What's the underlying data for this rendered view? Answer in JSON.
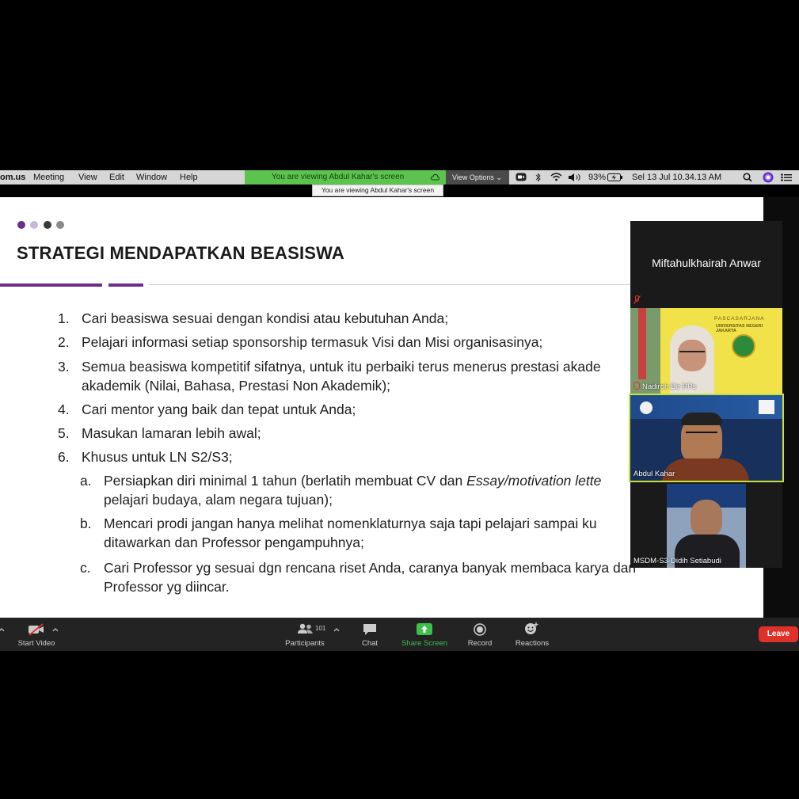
{
  "menubar": {
    "app_name": "om.us",
    "menus": [
      "Meeting",
      "View",
      "Edit",
      "Window",
      "Help"
    ],
    "viewing_banner": "You are viewing Abdul Kahar's screen",
    "view_options": "View Options ⌄",
    "battery": "93%",
    "datetime": "Sel 13 Jul  10.34.13 AM",
    "tooltip": "You are viewing Abdul Kahar's screen"
  },
  "slide": {
    "title": "STRATEGI MENDAPATKAN BEASISWA",
    "dot_colors": [
      "#6b2f8e",
      "#c8b8d8",
      "#3a3a3a",
      "#8a8a8a"
    ],
    "items": [
      {
        "num": "1.",
        "text": "Cari beasiswa sesuai dengan kondisi atau kebutuhan Anda;"
      },
      {
        "num": "2.",
        "text": "Pelajari informasi setiap sponsorship termasuk Visi dan Misi organisasinya;"
      },
      {
        "num": "3.",
        "text": "Semua beasiswa kompetitif sifatnya, untuk itu perbaiki terus menerus prestasi akade",
        "text2": "akademik (Nilai, Bahasa, Prestasi Non Akademik);"
      },
      {
        "num": "4.",
        "text": "Cari mentor yang baik dan tepat untuk Anda;"
      },
      {
        "num": "5.",
        "text": "Masukan lamaran lebih awal;"
      },
      {
        "num": "6.",
        "text": "Khusus untuk LN S2/S3;"
      }
    ],
    "subitems": [
      {
        "letter": "a.",
        "text_a": "Persiapkan diri minimal 1 tahun (berlatih membuat CV dan ",
        "text_italic": "Essay/motivation lette",
        "text2": "pelajari budaya, alam negara tujuan);"
      },
      {
        "letter": "b.",
        "text": "Mencari prodi jangan hanya melihat nomenklaturnya saja tapi pelajari sampai ku",
        "text2": "ditawarkan dan Professor pengampuhnya;"
      },
      {
        "letter": "c.",
        "text": "Cari Professor yg sesuai dgn rencana riset Anda, caranya banyak membaca karya dan",
        "text2": "Professor yg diincar."
      }
    ]
  },
  "panel": {
    "active_speaker": "Miftahulkhairah Anwar",
    "tiles": [
      {
        "label": "Nadiroh Dir PPs",
        "poster_title": "PASCASARJANA",
        "poster_sub": "UNIVERSITAS NEGERI JAKARTA"
      },
      {
        "label": "Abdul Kahar"
      },
      {
        "label": "MSDM-S3-Didih Setiabudi"
      }
    ]
  },
  "toolbar": {
    "start_video": "Start Video",
    "participants": "Participants",
    "participants_count": "101",
    "chat": "Chat",
    "share_screen": "Share Screen",
    "record": "Record",
    "reactions": "Reactions",
    "leave": "Leave",
    "share_color": "#3fbf4a",
    "leave_color": "#e0302a"
  }
}
